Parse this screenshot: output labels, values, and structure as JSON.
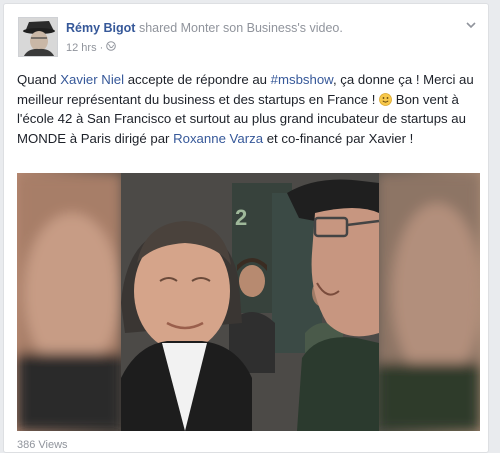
{
  "post": {
    "author": "Rémy Bigot",
    "action": "shared Monter son Business's video.",
    "time": "12 hrs",
    "separator": "·",
    "text": {
      "p1": "Quand ",
      "mention1": "Xavier Niel",
      "p2": " accepte de répondre au ",
      "hashtag": "#msbshow",
      "p3": ", ça donne ça ! Merci au meilleur représentant du business et des startups en France ! ",
      "p4": " Bon vent à l'école 42 à San Francisco et surtout au plus grand incubateur de startups au MONDE à Paris dirigé par ",
      "mention2": "Roxanne Varza",
      "p5": " et co-financé par Xavier !"
    },
    "views": "386 Views"
  },
  "colors": {
    "link": "#365899",
    "meta": "#90949c",
    "text": "#1d2129",
    "background": "#e9ebee"
  },
  "icons": {
    "privacy": "globe-icon",
    "menu": "chevron-down-icon",
    "emoji": "smiley-icon"
  }
}
